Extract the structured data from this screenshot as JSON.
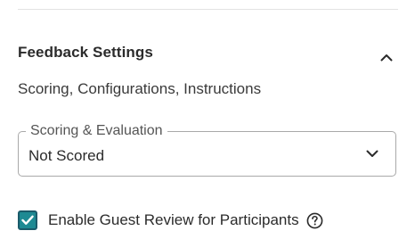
{
  "section": {
    "title": "Feedback Settings",
    "subtitle": "Scoring, Configurations, Instructions",
    "collapse_icon": "chevron-up-icon"
  },
  "scoring": {
    "label": "Scoring & Evaluation",
    "selected_value": "Not Scored",
    "dropdown_icon": "chevron-down-icon"
  },
  "guest_review": {
    "label": "Enable Guest Review for Participants",
    "checked": true,
    "checkbox_color": "#1e8a93",
    "help_icon": "question-circle-icon"
  }
}
